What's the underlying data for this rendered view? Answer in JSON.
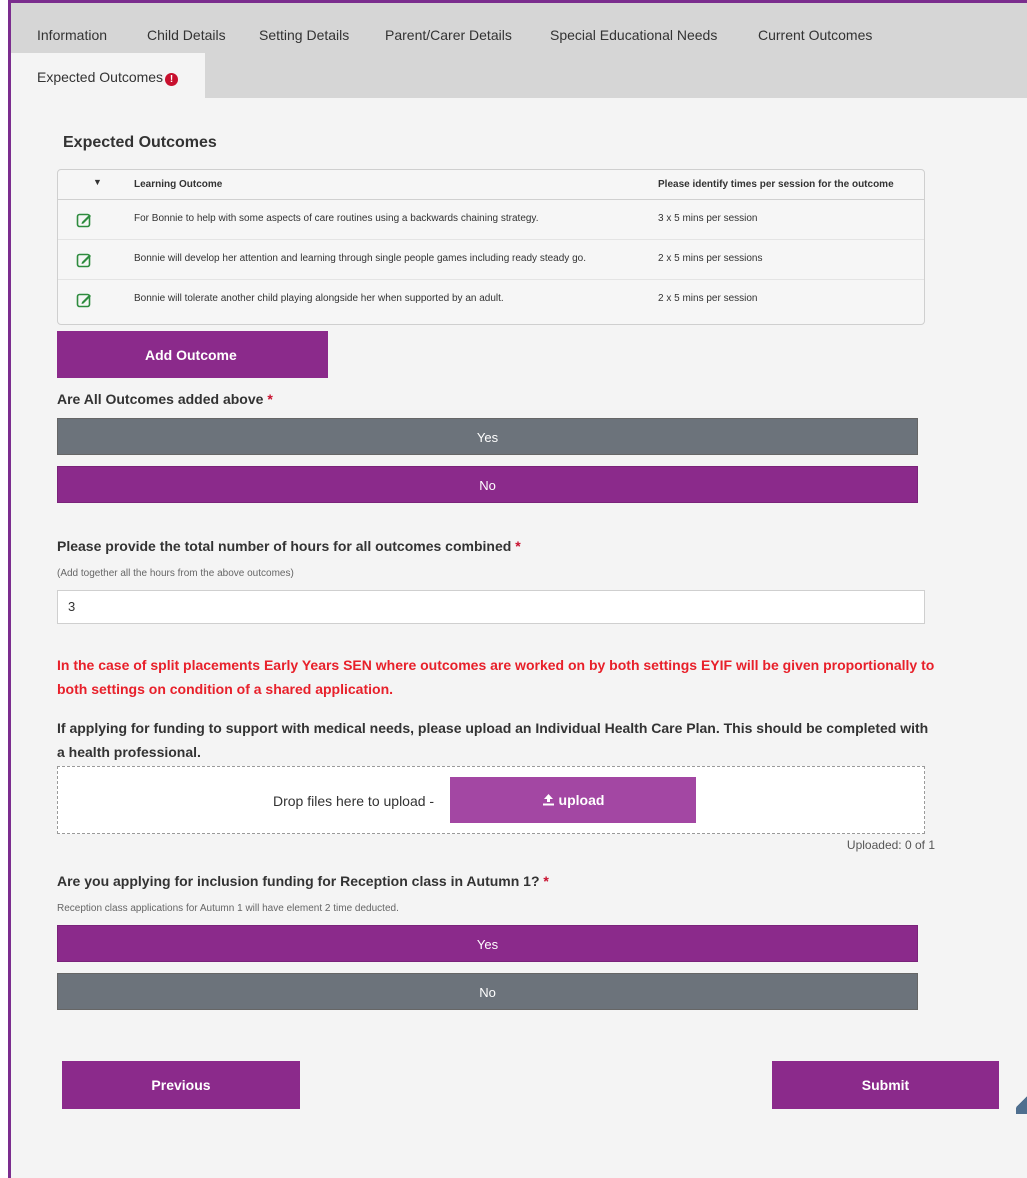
{
  "tabs": [
    {
      "label": "Information"
    },
    {
      "label": "Child Details"
    },
    {
      "label": "Setting Details"
    },
    {
      "label": "Parent/Carer Details"
    },
    {
      "label": "Special Educational Needs"
    },
    {
      "label": "Current Outcomes"
    },
    {
      "label": "Expected Outcomes",
      "active": true,
      "alert_icon": "exclamation-circle-icon",
      "alert": "!"
    }
  ],
  "section": {
    "title": "Expected Outcomes"
  },
  "outcomes_table": {
    "sort_glyph": "▼",
    "columns": [
      "Learning Outcome",
      "Please identify times per session for the outcome"
    ],
    "rows": [
      {
        "outcome": "For Bonnie to help with some aspects of care routines using a backwards chaining strategy.",
        "times": "3 x 5 mins per session"
      },
      {
        "outcome": "Bonnie will develop her attention and learning through single people games including ready steady go.",
        "times": "2 x 5 mins per sessions"
      },
      {
        "outcome": "Bonnie will tolerate another child playing alongside her when supported by an adult.",
        "times": "2 x 5 mins per session"
      }
    ]
  },
  "add_outcome_label": "Add Outcome",
  "all_outcomes": {
    "question": "Are All Outcomes added above",
    "required_mark": "*",
    "yes": "Yes",
    "no": "No"
  },
  "total_hours": {
    "question": "Please provide the total number of hours for all outcomes combined",
    "required_mark": "*",
    "hint": "(Add together all the hours from the above outcomes)",
    "value": "3"
  },
  "split_note": "In the case of split placements Early Years SEN where outcomes are worked on by both settings EYIF will be given proportionally to both settings on condition of a shared application.",
  "medical_note": "If applying for funding to support with medical needs, please upload an Individual Health Care Plan. This should be completed with a health professional.",
  "upload": {
    "drop_text": "Drop files here to upload -",
    "button_label": "upload",
    "icon": "upload-icon",
    "status": "Uploaded: 0 of 1"
  },
  "reception": {
    "question": "Are you applying for inclusion funding for Reception class in Autumn 1?",
    "required_mark": "*",
    "hint": "Reception class applications for Autumn 1 will have element 2 time deducted.",
    "yes": "Yes",
    "no": "No"
  },
  "nav": {
    "previous": "Previous",
    "submit": "Submit"
  },
  "colors": {
    "brand_purple": "#8b2a8b",
    "grey_button": "#6c737b",
    "alert_red": "#e8202a"
  }
}
